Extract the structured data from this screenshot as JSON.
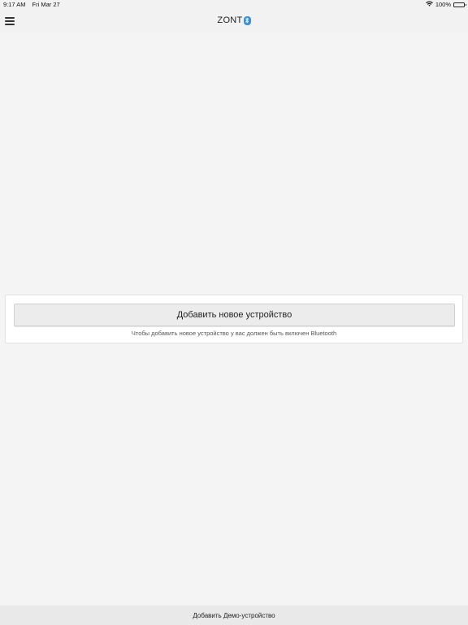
{
  "status_bar": {
    "time": "9:17 AM",
    "date": "Fri Mar 27",
    "battery_percent": "100%",
    "battery_level": 1.0,
    "wifi_icon": "wifi-icon",
    "battery_icon": "battery-icon"
  },
  "nav": {
    "title": "ZONT",
    "menu_icon": "hamburger-menu-icon",
    "title_badge_icon": "bluetooth-icon",
    "accent_color": "#3a8fd6"
  },
  "main": {
    "add_device_label": "Добавить новое устройство",
    "hint": "Чтобы добавить новое устройство у вас должен быть включен Bluetooth"
  },
  "footer": {
    "demo_label": "Добавить Демо-устройство"
  }
}
